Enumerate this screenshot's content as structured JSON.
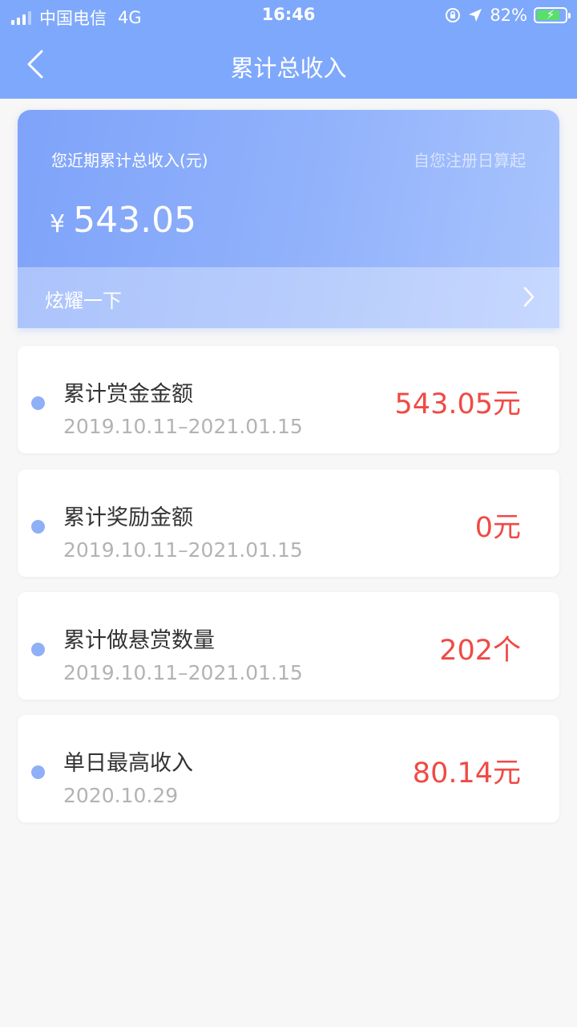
{
  "status_bar": {
    "carrier": "中国电信",
    "network": "4G",
    "time": "16:46",
    "battery": "82%",
    "battery_level": 0.82
  },
  "nav": {
    "title": "累计总收入"
  },
  "summary": {
    "label": "您近期累计总收入(元)",
    "note": "自您注册日算起",
    "currency": "¥",
    "amount": "543.05",
    "show_off": "炫耀一下"
  },
  "cards": [
    {
      "title": "累计赏金金额",
      "date": "2019.10.11–2021.01.15",
      "value": "543.05元"
    },
    {
      "title": "累计奖励金额",
      "date": "2019.10.11–2021.01.15",
      "value": "0元"
    },
    {
      "title": "累计做悬赏数量",
      "date": "2019.10.11–2021.01.15",
      "value": "202个"
    },
    {
      "title": "单日最高收入",
      "date": "2020.10.29",
      "value": "80.14元"
    }
  ],
  "colors": {
    "header": "#7ea8fb",
    "accent_dot": "#8fb0f7",
    "value_red": "#f04a46"
  }
}
